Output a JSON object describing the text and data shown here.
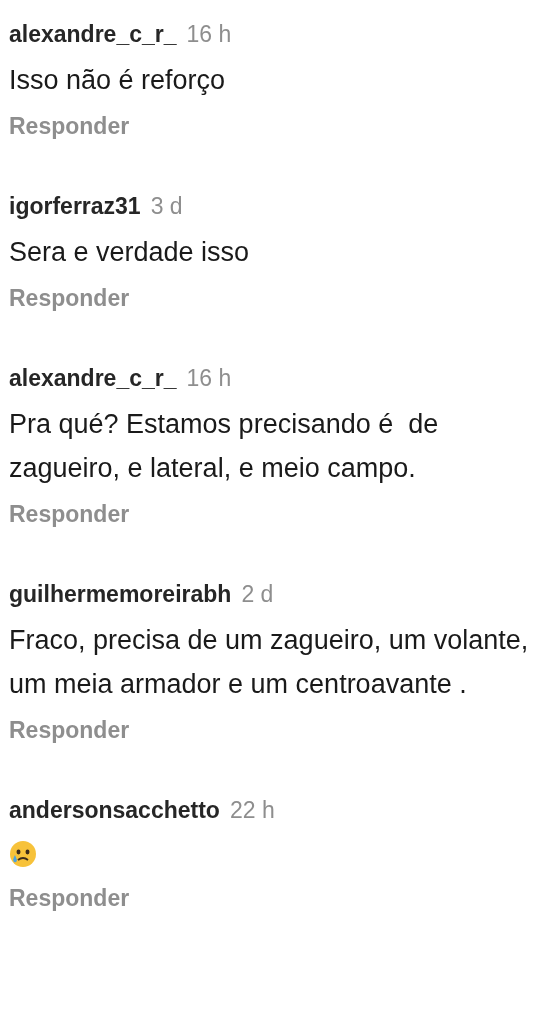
{
  "comments": [
    {
      "username": "alexandre_c_r_",
      "time": "16 h",
      "kind": "text",
      "text": "Isso não é reforço",
      "reply": "Responder"
    },
    {
      "username": "igorferraz31",
      "time": "3 d",
      "kind": "text",
      "text": "Sera e verdade isso",
      "reply": "Responder"
    },
    {
      "username": "alexandre_c_r_",
      "time": "16 h",
      "kind": "text",
      "text": "Pra qué? Estamos precisando é  de zagueiro, e lateral, e meio campo.",
      "reply": "Responder"
    },
    {
      "username": "guilhermemoreirabh",
      "time": "2 d",
      "kind": "text",
      "text": "Fraco, precisa de um zagueiro, um volante, um meia armador e um centroavante .",
      "reply": "Responder"
    },
    {
      "username": "andersonsacchetto",
      "time": "22 h",
      "kind": "emoji",
      "reply": "Responder"
    }
  ]
}
